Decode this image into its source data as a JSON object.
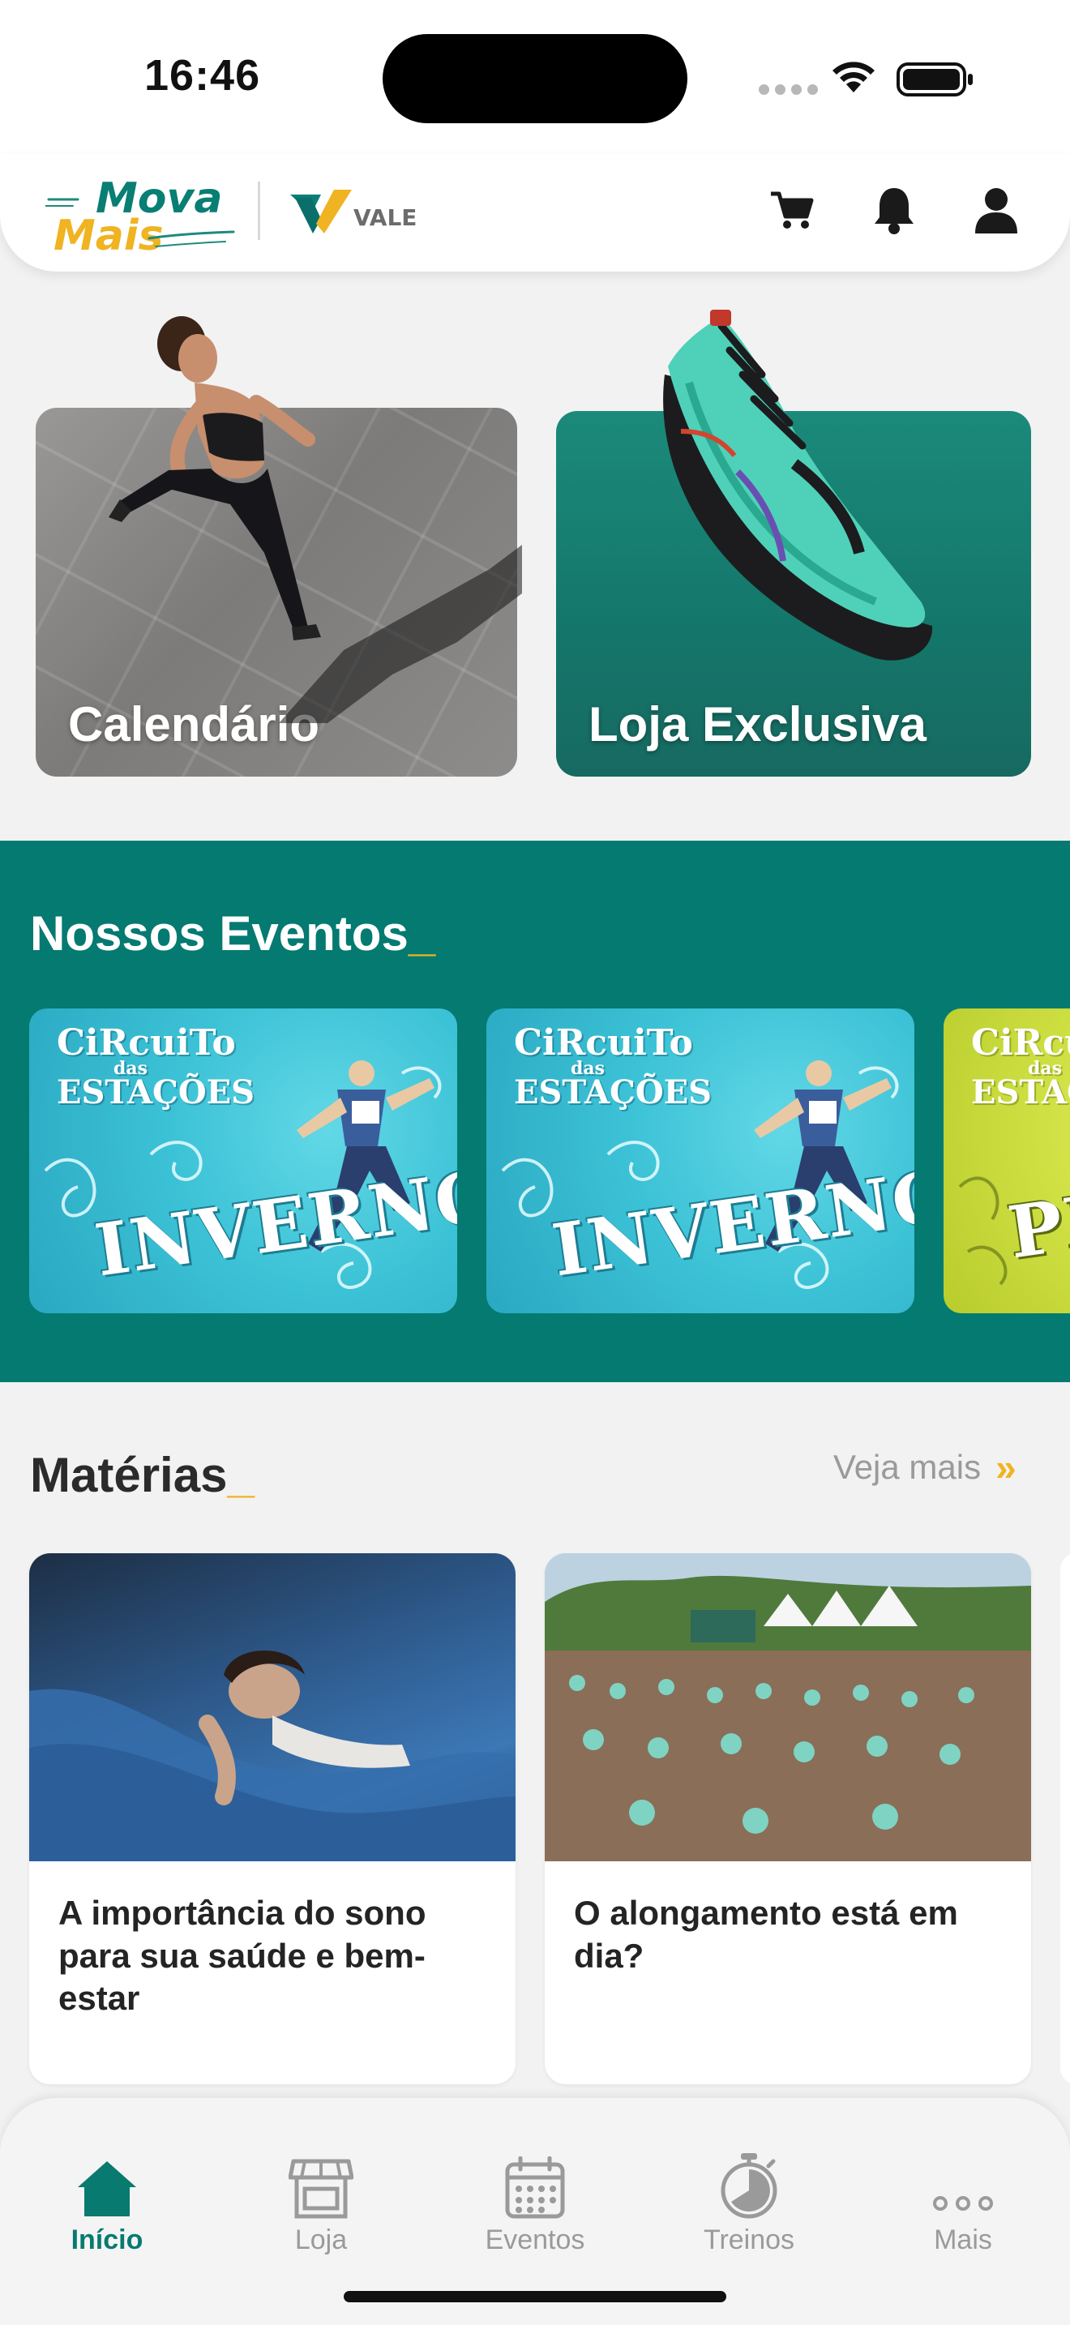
{
  "status_bar": {
    "time": "16:46"
  },
  "header": {
    "brand_line1": "Mova",
    "brand_line2": "Mais",
    "partner_logo_text": "VALE",
    "icons": [
      "cart-icon",
      "bell-icon",
      "user-icon"
    ]
  },
  "feature_cards": [
    {
      "label": "Calendário",
      "image": "runner-photo"
    },
    {
      "label": "Loja Exclusiva",
      "image": "running-shoe-photo"
    }
  ],
  "events": {
    "title": "Nossos Eventos",
    "title_suffix": "_",
    "cards": [
      {
        "brand_l1": "CiRcuiTo",
        "brand_l2": "das",
        "brand_l3": "ESTAÇÕES",
        "season": "INVERNO"
      },
      {
        "brand_l1": "CiRcuiTo",
        "brand_l2": "das",
        "brand_l3": "ESTAÇÕES",
        "season": "INVERNO"
      },
      {
        "brand_l1": "CiRcuiTo",
        "brand_l2": "das",
        "brand_l3": "ESTAÇÕES",
        "season": "PRI"
      }
    ]
  },
  "articles": {
    "title": "Matérias",
    "title_suffix": "_",
    "see_more": "Veja mais",
    "see_more_icon": "double-chevron-right-icon",
    "items": [
      {
        "title": "A importância do sono para sua saúde e bem-estar"
      },
      {
        "title": "O alongamento está em dia?"
      }
    ]
  },
  "tab_bar": {
    "tabs": [
      {
        "label": "Início",
        "icon": "home-icon",
        "active": true
      },
      {
        "label": "Loja",
        "icon": "store-icon",
        "active": false
      },
      {
        "label": "Eventos",
        "icon": "calendar-icon",
        "active": false
      },
      {
        "label": "Treinos",
        "icon": "stopwatch-icon",
        "active": false
      },
      {
        "label": "Mais",
        "icon": "more-dots-icon",
        "active": false
      }
    ]
  },
  "colors": {
    "brand_teal": "#047a71",
    "accent_yellow": "#f0b321",
    "active_tab": "#087a70",
    "inactive_tab": "#9a9a9a",
    "background": "#f2f2f2"
  }
}
